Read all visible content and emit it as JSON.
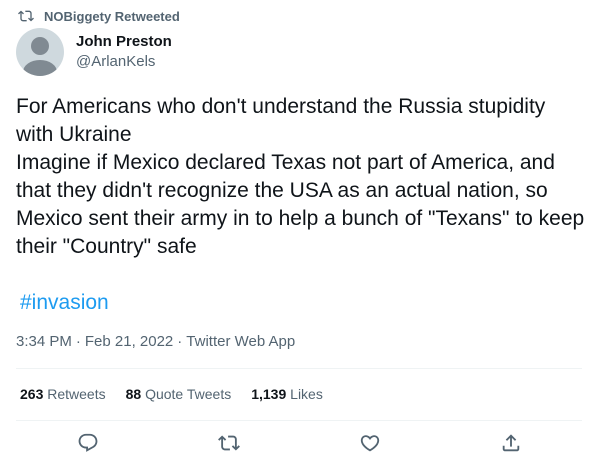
{
  "retweet_banner": {
    "label": "NOBiggety Retweeted",
    "icon": "retweet-icon"
  },
  "author": {
    "display_name": "John Preston",
    "handle": "@ArlanKels",
    "avatar": "default-avatar"
  },
  "tweet": {
    "text": "For Americans who don't understand the Russia stupidity with Ukraine\nImagine if Mexico declared Texas not part of America, and that they didn't recognize the USA as an actual nation, so Mexico sent their army in to help a bunch of \"Texans\" to keep their \"Country\" safe",
    "hashtag": "#invasion"
  },
  "meta": {
    "time": "3:34 PM",
    "sep1": "·",
    "date": "Feb 21, 2022",
    "sep2": "·",
    "source": "Twitter Web App"
  },
  "stats": {
    "retweets_count": "263",
    "retweets_label": "Retweets",
    "quotes_count": "88",
    "quotes_label": "Quote Tweets",
    "likes_count": "1,139",
    "likes_label": "Likes"
  },
  "actions": [
    "reply-icon",
    "retweet-icon",
    "like-icon",
    "share-icon"
  ],
  "colors": {
    "link": "#1d9bf0",
    "secondary": "#536471",
    "primary": "#0f1419",
    "divider": "#eff3f4"
  }
}
